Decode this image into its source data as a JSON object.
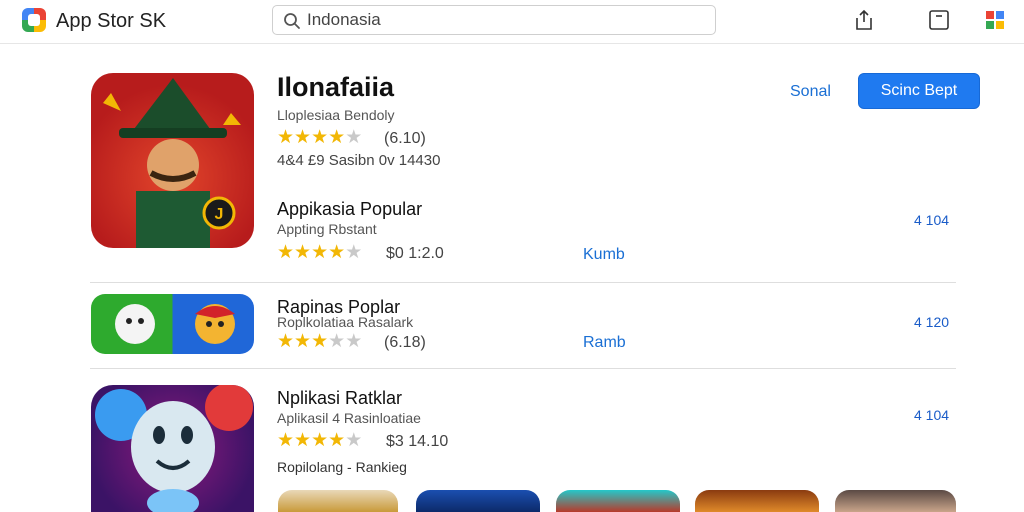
{
  "header": {
    "app_title": "App Stor  SK",
    "search": {
      "value": "Indonasia",
      "placeholder": "Indonasia"
    },
    "icons": [
      "share-icon",
      "bookmark-icon",
      "puzzle-icon"
    ]
  },
  "featured": {
    "title": "Ilonafaiia",
    "developer": "Lloplesiaa Bendoly",
    "rating_value": 4,
    "rating_text": "(6.10)",
    "meta": "4&4 £9   Sasibn 0v  14430",
    "secondary_button": "Sonal",
    "primary_button": "Scinc Bept"
  },
  "list": [
    {
      "name": "Appikasia Popular",
      "subtitle": "Appting Rbstant",
      "rating_value": 4,
      "rating_text": "$0  1:2.0",
      "action": "Kumb",
      "rank": "4 104"
    },
    {
      "name": "Rapinas Poplar",
      "subtitle": "Roplkolatiaa Rasalark",
      "rating_value": 3.5,
      "rating_text": "(6.18)",
      "action": "Ramb",
      "rank": "4 120"
    },
    {
      "name": "Nplikasi Ratklar",
      "subtitle": "Aplikasil 4 Rasinloatiae",
      "rating_value": 4,
      "rating_text": "$3  14.10",
      "caption": "Ropilolang - Rankieg",
      "rank": "4 104"
    }
  ],
  "colors": {
    "accent": "#1f7af0",
    "star": "#f2b705",
    "link": "#1a6fd4"
  }
}
